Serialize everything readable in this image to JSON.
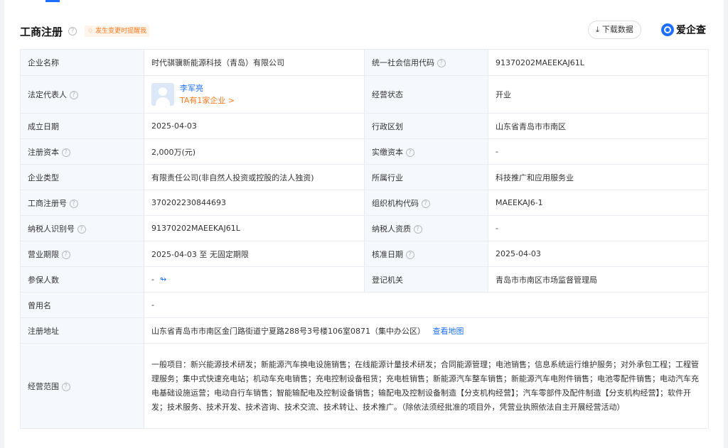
{
  "header": {
    "title": "工商注册",
    "help_icon": "?",
    "notify_label": "发生变更时提醒我",
    "download_label": "下载数据",
    "logo_text": "爱企查"
  },
  "rows": [
    {
      "l1": "企业名称",
      "v1": "时代骐骥新能源科技（青岛）有限公司",
      "l2": "统一社会信用代码",
      "v2": "91370202MAEEKAJ61L"
    },
    {
      "l1": "法定代表人",
      "legal_name": "李军亮",
      "legal_sub": "TA有1家企业 >",
      "l2": "经营状态",
      "v2": "开业"
    },
    {
      "l1": "成立日期",
      "v1": "2025-04-03",
      "l2": "行政区划",
      "v2": "山东省青岛市市南区"
    },
    {
      "l1": "注册资本",
      "v1": "2,000万(元)",
      "l2": "实缴资本",
      "v2": "-"
    },
    {
      "l1": "企业类型",
      "v1": "有限责任公司(非自然人投资或控股的法人独资)",
      "l2": "所属行业",
      "v2": "科技推广和应用服务业"
    },
    {
      "l1": "工商注册号",
      "v1": "370202230844693",
      "l2": "组织机构代码",
      "v2": "MAEEKAJ6-1"
    },
    {
      "l1": "纳税人识别号",
      "v1": "91370202MAEEKAJ61L",
      "l2": "纳税人资质",
      "v2": "-"
    },
    {
      "l1": "营业期限",
      "v1": "2025-04-03 至 无固定期限",
      "l2": "核准日期",
      "v2": "2025-04-03"
    },
    {
      "l1": "参保人数",
      "v1": "-",
      "l2": "登记机关",
      "v2": "青岛市市南区市场监督管理局"
    },
    {
      "l1": "曾用名",
      "v1": "-"
    },
    {
      "l1": "注册地址",
      "v1": "山东省青岛市市南区金门路街道宁夏路288号3号楼106室0871（集中办公区）",
      "map_link": "查看地图"
    },
    {
      "l1": "经营范围",
      "v1": "一般项目：新兴能源技术研发；新能源汽车换电设施销售；在线能源计量技术研发；合同能源管理；电池销售；信息系统运行维护服务；对外承包工程；工程管理服务；集中式快速充电站；机动车充电销售；充电控制设备租赁；充电桩销售；新能源汽车整车销售；新能源汽车电附件销售；电池零配件销售；电动汽车充电基础设施运营；电动自行车销售；智能输配电及控制设备销售；输配电及控制设备制造【分支机构经营】；汽车零部件及配件制造【分支机构经营】；软件开发；技术服务、技术开发、技术咨询、技术交流、技术转让、技术推广。（除依法须经批准的项目外，凭营业执照依法自主开展经营活动）"
    }
  ]
}
